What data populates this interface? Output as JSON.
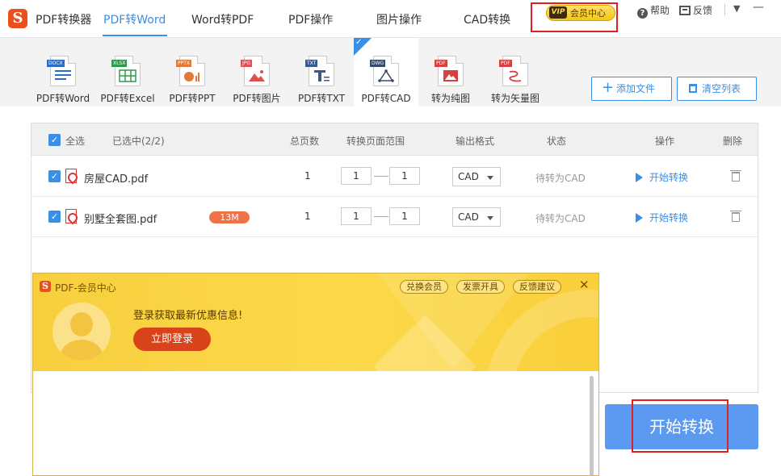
{
  "app": {
    "name": "PDF转换器",
    "logo_glyph": "S",
    "brand_color": "#e8501e",
    "accent_color": "#3a8ee6"
  },
  "nav": {
    "items": [
      {
        "label": "PDF转Word",
        "active": true
      },
      {
        "label": "Word转PDF"
      },
      {
        "label": "PDF操作"
      },
      {
        "label": "图片操作"
      },
      {
        "label": "CAD转换"
      }
    ],
    "vip": {
      "badge": "VIP",
      "label": "会员中心"
    }
  },
  "top_tools": {
    "help": "帮助",
    "feedback": "反馈"
  },
  "tools": [
    {
      "label": "PDF转Word",
      "tag": "DOCX",
      "color": "#2b6cc4"
    },
    {
      "label": "PDF转Excel",
      "tag": "XLSX",
      "color": "#2f9a4a"
    },
    {
      "label": "PDF转PPT",
      "tag": "PPTX",
      "color": "#e07a3a"
    },
    {
      "label": "PDF转图片",
      "tag": "JPG",
      "color": "#e05050"
    },
    {
      "label": "PDF转TXT",
      "tag": "TXT",
      "color": "#3a5a8c"
    },
    {
      "label": "PDF转CAD",
      "tag": "DWG",
      "color": "#3a4a6a",
      "selected": true
    },
    {
      "label": "转为纯图",
      "tag": "PDF",
      "color": "#d84040"
    },
    {
      "label": "转为矢量图",
      "tag": "PDF",
      "color": "#d84040"
    }
  ],
  "actions": {
    "add_file": "添加文件",
    "clear_list": "清空列表"
  },
  "table": {
    "headers": {
      "select_all": "全选",
      "selected": "已选中(2/2)",
      "pages": "总页数",
      "range": "转换页面范围",
      "format": "输出格式",
      "status": "状态",
      "operation": "操作",
      "delete": "删除"
    },
    "rows": [
      {
        "name": "房屋CAD.pdf",
        "size": "",
        "pages": "1",
        "from": "1",
        "to": "1",
        "format": "CAD",
        "status": "待转为CAD",
        "action": "开始转换"
      },
      {
        "name": "别墅全套图.pdf",
        "size": "13M",
        "pages": "1",
        "from": "1",
        "to": "1",
        "format": "CAD",
        "status": "待转为CAD",
        "action": "开始转换"
      }
    ]
  },
  "start_button": "开始转换",
  "popup": {
    "title": "PDF-会员中心",
    "buttons": [
      "兑换会员",
      "发票开具",
      "反馈建议"
    ],
    "promo": "登录获取最新优惠信息!",
    "login": "立即登录"
  }
}
